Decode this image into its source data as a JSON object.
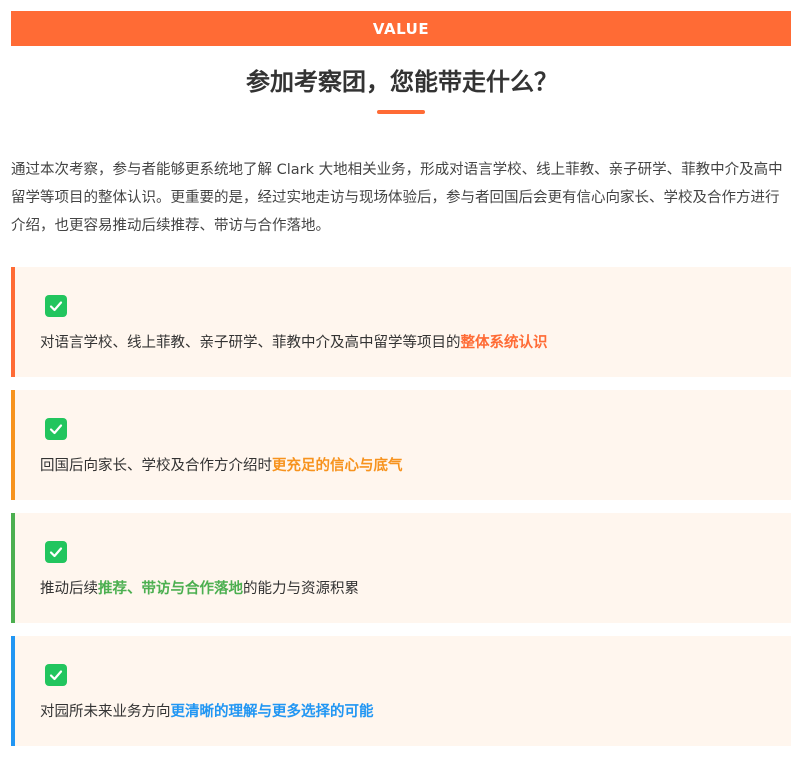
{
  "header": {
    "banner_label": "VALUE",
    "title": "参加考察团，您能带走什么？"
  },
  "intro": {
    "paragraph": "通过本次考察，参与者能够更系统地了解 Clark 大地相关业务，形成对语言学校、线上菲教、亲子研学、菲教中介及高中留学等项目的整体认识。更重要的是，经过实地走访与现场体验后，参与者回国后会更有信心向家长、学校及合作方进行介绍，也更容易推动后续推荐、带访与合作落地。"
  },
  "cards": [
    {
      "icon": "check-icon",
      "accent": "#ff6b35",
      "prefix": "对语言学校、线上菲教、亲子研学、菲教中介及高中留学等项目的",
      "highlight": "整体系统认识",
      "suffix": ""
    },
    {
      "icon": "check-icon",
      "accent": "#f7931e",
      "prefix": "回国后向家长、学校及合作方介绍时",
      "highlight": "更充足的信心与底气",
      "suffix": ""
    },
    {
      "icon": "check-icon",
      "accent": "#4caf50",
      "prefix": "推动后续",
      "highlight": "推荐、带访与合作落地",
      "suffix": "的能力与资源积累"
    },
    {
      "icon": "check-icon",
      "accent": "#2196f3",
      "prefix": "对园所未来业务方向",
      "highlight": "更清晰的理解与更多选择的可能",
      "suffix": ""
    }
  ],
  "colors": {
    "brand": "#ff6b35",
    "card_bg": "#fff6ee",
    "check": "#22c55e"
  }
}
